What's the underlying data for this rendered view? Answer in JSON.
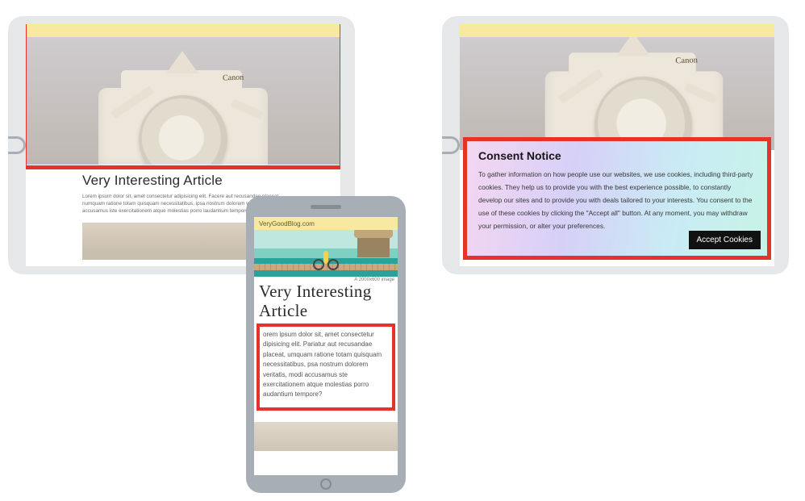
{
  "tablet_left": {
    "article_title": "Very Interesting Article",
    "lorem": "Lorem ipsum dolor sit, amet consectetur adipisicing elit. Facere aut recusandae placeat, numquam ratione totam quisquam necessitatibus, ipsa nostrum dolorem veritatis, modi accusamus iste exercitationem atque molestias porro laudantium tempore?",
    "camera_brand": "Canon",
    "hero_alt": "paper-camera-photo"
  },
  "tablet_right": {
    "camera_brand": "Canon",
    "hero_alt": "paper-camera-photo",
    "consent": {
      "title": "Consent Notice",
      "body": "To gather information on how people use our websites, we use cookies, including third-party cookies. They help us to provide you with the best experience possible, to constantly develop our sites and to provide you with deals tailored to your interests. You consent to the use of these cookies by clicking the \"Accept all\" button. At any moment, you may withdraw your permission, or alter your preferences.",
      "accept_label": "Accept Cookies"
    }
  },
  "phone": {
    "site_name": "VeryGoodBlog.com",
    "hero_caption": "A 2000x600 image",
    "article_title": "Very Interesting Article",
    "body": "orem ipsum dolor sit, amet consectetur dipisicing elit. Pariatur aut recusandae placeat, umquam ratione totam quisquam necessitatibus, psa nostrum dolorem veritatis, modi accusamus ste exercitationem atque molestias porro audantium tempore?",
    "hero_alt": "beach-pier-bicycle"
  },
  "highlight_color": "#e5332a"
}
